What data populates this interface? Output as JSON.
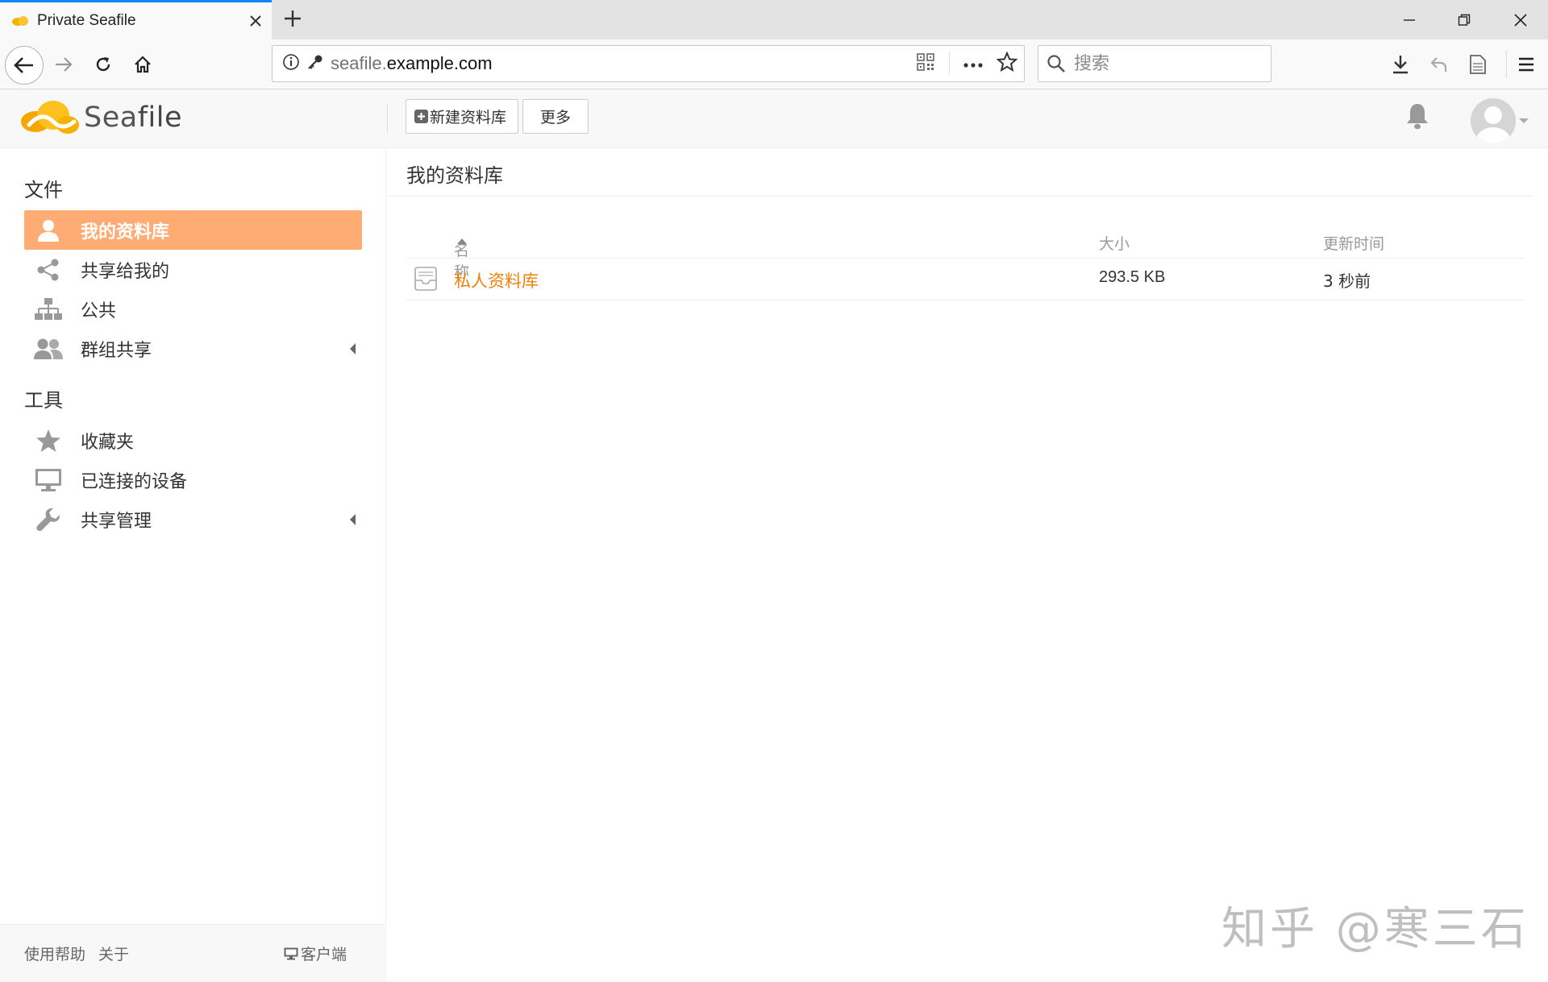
{
  "browser": {
    "tab_title": "Private Seafile",
    "url_host_prefix": "seafile.",
    "url_host_main": "example.com",
    "search_placeholder": "搜索"
  },
  "header": {
    "logo_sea": "Sea",
    "logo_file": "file",
    "new_library_label": "新建资料库",
    "more_label": "更多"
  },
  "sidebar": {
    "files_heading": "文件",
    "items": [
      {
        "label": "我的资料库"
      },
      {
        "label": "共享给我的"
      },
      {
        "label": "公共"
      },
      {
        "label": "群组共享"
      }
    ],
    "tools_heading": "工具",
    "tools": [
      {
        "label": "收藏夹"
      },
      {
        "label": "已连接的设备"
      },
      {
        "label": "共享管理"
      }
    ],
    "footer": {
      "help": "使用帮助",
      "about": "关于",
      "client": "客户端"
    }
  },
  "main": {
    "title": "我的资料库",
    "columns": {
      "name": "名称",
      "size": "大小",
      "updated": "更新时间"
    },
    "rows": [
      {
        "name": "私人资料库",
        "size": "293.5 KB",
        "updated": "3 秒前"
      }
    ]
  },
  "watermark": "知乎 @寒三石",
  "colors": {
    "accent": "#feac74",
    "link": "#eb8205",
    "tab_highlight": "#0a84ff"
  }
}
